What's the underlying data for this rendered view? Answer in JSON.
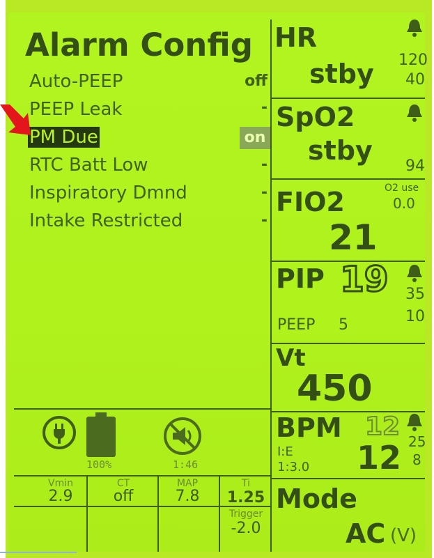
{
  "alarm_config": {
    "title": "Alarm Config",
    "items": [
      {
        "label": "Auto-PEEP",
        "value": "off"
      },
      {
        "label": "PEEP Leak",
        "value": "-"
      },
      {
        "label": "PM Due",
        "value": "on"
      },
      {
        "label": "RTC Batt Low",
        "value": "-"
      },
      {
        "label": "Inspiratory Dmnd",
        "value": "-"
      },
      {
        "label": "Intake Restricted",
        "value": "-"
      }
    ]
  },
  "hr": {
    "label": "HR",
    "value": "stby",
    "high": "120",
    "low": "40",
    "icon": "bell-icon"
  },
  "spo2": {
    "label": "SpO2",
    "value": "stby",
    "low": "94",
    "icon": "bell-icon"
  },
  "fio2": {
    "label": "FIO2",
    "value": "21",
    "o2_use_label": "O2 use",
    "o2_use_value": "0.0"
  },
  "pip": {
    "label": "PIP",
    "value": "19",
    "high": "35",
    "low": "10",
    "peep_label": "PEEP",
    "peep_value": "5",
    "icon": "bell-icon"
  },
  "vt": {
    "label": "Vt",
    "value": "450"
  },
  "bpm": {
    "label": "BPM",
    "set": "12",
    "value": "12",
    "high": "25",
    "low": "8",
    "ie_label": "I:E",
    "ie_value": "1:3.0",
    "icon": "bell-icon"
  },
  "mode": {
    "label": "Mode",
    "value": "AC",
    "suffix": "(V)"
  },
  "status": {
    "battery_percent_text": "100%",
    "battery_level": 1.0,
    "mute_time": "1:46",
    "icons": [
      "plug-icon",
      "battery-icon",
      "audio-mute-icon"
    ]
  },
  "readings": [
    {
      "label": "Vmin",
      "value": "2.9"
    },
    {
      "label": "CT",
      "value": "off"
    },
    {
      "label": "MAP",
      "value": "7.8"
    },
    {
      "label": "Ti",
      "value": "1.25"
    },
    {
      "label": "Trigger",
      "value": "-2.0"
    }
  ],
  "colors": {
    "screen": "#b0f21c",
    "ink": "#344f15",
    "arrow": "#e2161b"
  }
}
